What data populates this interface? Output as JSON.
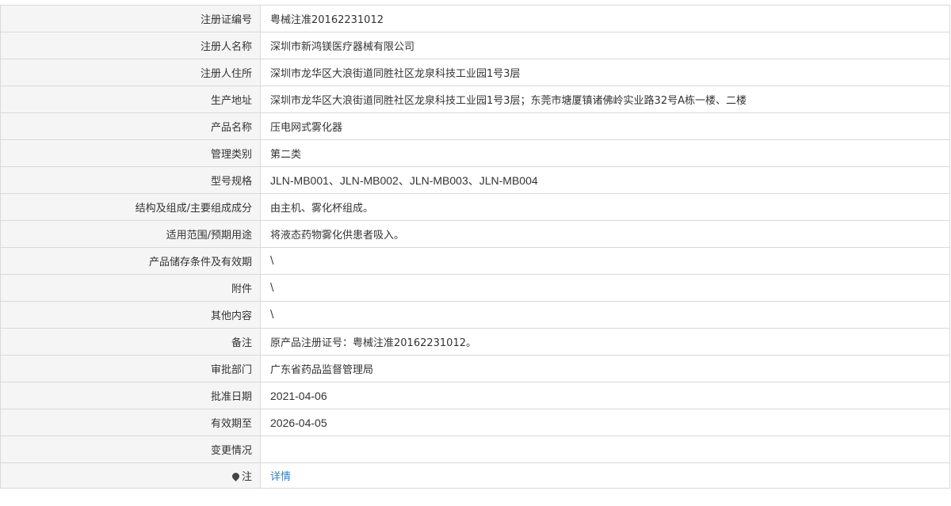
{
  "rows": [
    {
      "label": "注册证编号",
      "value": "粤械注准20162231012"
    },
    {
      "label": "注册人名称",
      "value": "深圳市新鸿镁医疗器械有限公司"
    },
    {
      "label": "注册人住所",
      "value": "深圳市龙华区大浪街道同胜社区龙泉科技工业园1号3层"
    },
    {
      "label": "生产地址",
      "value": "深圳市龙华区大浪街道同胜社区龙泉科技工业园1号3层；东莞市塘厦镇诸佛岭实业路32号A栋一楼、二楼"
    },
    {
      "label": "产品名称",
      "value": "压电网式雾化器"
    },
    {
      "label": "管理类别",
      "value": "第二类"
    },
    {
      "label": "型号规格",
      "value": "JLN-MB001、JLN-MB002、JLN-MB003、JLN-MB004"
    },
    {
      "label": "结构及组成/主要组成成分",
      "value": "由主机、雾化杯组成。"
    },
    {
      "label": "适用范围/预期用途",
      "value": "将液态药物雾化供患者吸入。"
    },
    {
      "label": "产品储存条件及有效期",
      "value": "\\"
    },
    {
      "label": "附件",
      "value": "\\"
    },
    {
      "label": "其他内容",
      "value": "\\"
    },
    {
      "label": "备注",
      "value": "原产品注册证号：粤械注准20162231012。"
    },
    {
      "label": "审批部门",
      "value": "广东省药品监督管理局"
    },
    {
      "label": "批准日期",
      "value": "2021-04-06"
    },
    {
      "label": "有效期至",
      "value": "2026-04-05"
    },
    {
      "label": "变更情况",
      "value": ""
    }
  ],
  "note": {
    "icon": "location-pin-icon",
    "label": "注",
    "link_text": "详情",
    "link_color": "#2a7fcf"
  }
}
